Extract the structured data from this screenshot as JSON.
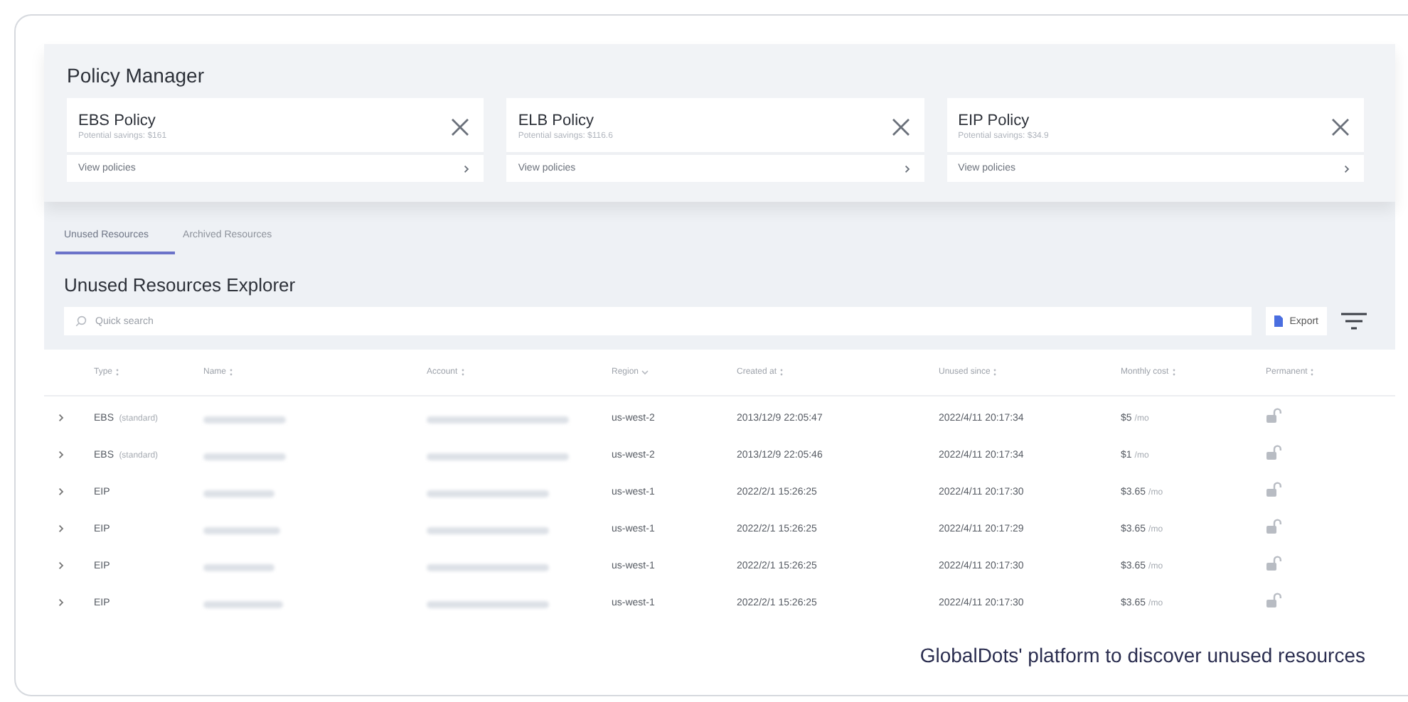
{
  "policy_manager": {
    "title": "Policy Manager",
    "cards": [
      {
        "title": "EBS Policy",
        "savings": "Potential savings: $161",
        "link": "View policies"
      },
      {
        "title": "ELB Policy",
        "savings": "Potential savings: $116.6",
        "link": "View policies"
      },
      {
        "title": "EIP Policy",
        "savings": "Potential savings: $34.9",
        "link": "View policies"
      }
    ]
  },
  "tabs": [
    {
      "label": "Unused Resources",
      "selected": true
    },
    {
      "label": "Archived Resources",
      "selected": false
    }
  ],
  "explorer": {
    "title": "Unused Resources Explorer",
    "search": {
      "placeholder": "Quick search"
    },
    "export_button": "Export"
  },
  "table": {
    "columns": [
      {
        "label": "Type",
        "kind": "sortable"
      },
      {
        "label": "Name",
        "kind": "sortable"
      },
      {
        "label": "Account",
        "kind": "sortable"
      },
      {
        "label": "Region",
        "kind": "sorted"
      },
      {
        "label": "Created at",
        "kind": "sortable"
      },
      {
        "label": "Unused since",
        "kind": "sortable"
      },
      {
        "label": "Monthly cost",
        "kind": "sortable"
      },
      {
        "label": "Permanent",
        "kind": "sortable"
      }
    ],
    "rows": [
      {
        "type": "EBS",
        "subtype": "(standard)",
        "region": "us-west-2",
        "created": "2013/12/9 22:05:47",
        "unused_since": "2022/4/11 20:17:34",
        "cost": "$5",
        "unit": "/mo",
        "permanent": false
      },
      {
        "type": "EBS",
        "subtype": "(standard)",
        "region": "us-west-2",
        "created": "2013/12/9 22:05:46",
        "unused_since": "2022/4/11 20:17:34",
        "cost": "$1",
        "unit": "/mo",
        "permanent": false
      },
      {
        "type": "EIP",
        "region": "us-west-1",
        "created": "2022/2/1 15:26:25",
        "unused_since": "2022/4/11 20:17:30",
        "cost": "$3.65",
        "unit": "/mo",
        "permanent": false
      },
      {
        "type": "EIP",
        "region": "us-west-1",
        "created": "2022/2/1 15:26:25",
        "unused_since": "2022/4/11 20:17:29",
        "cost": "$3.65",
        "unit": "/mo",
        "permanent": false
      },
      {
        "type": "EIP",
        "region": "us-west-1",
        "created": "2022/2/1 15:26:25",
        "unused_since": "2022/4/11 20:17:30",
        "cost": "$3.65",
        "unit": "/mo",
        "permanent": false
      },
      {
        "type": "EIP",
        "region": "us-west-1",
        "created": "2022/2/1 15:26:25",
        "unused_since": "2022/4/11 20:17:30",
        "cost": "$3.65",
        "unit": "/mo",
        "permanent": false
      }
    ]
  },
  "caption": "GlobalDots' platform to discover unused resources"
}
